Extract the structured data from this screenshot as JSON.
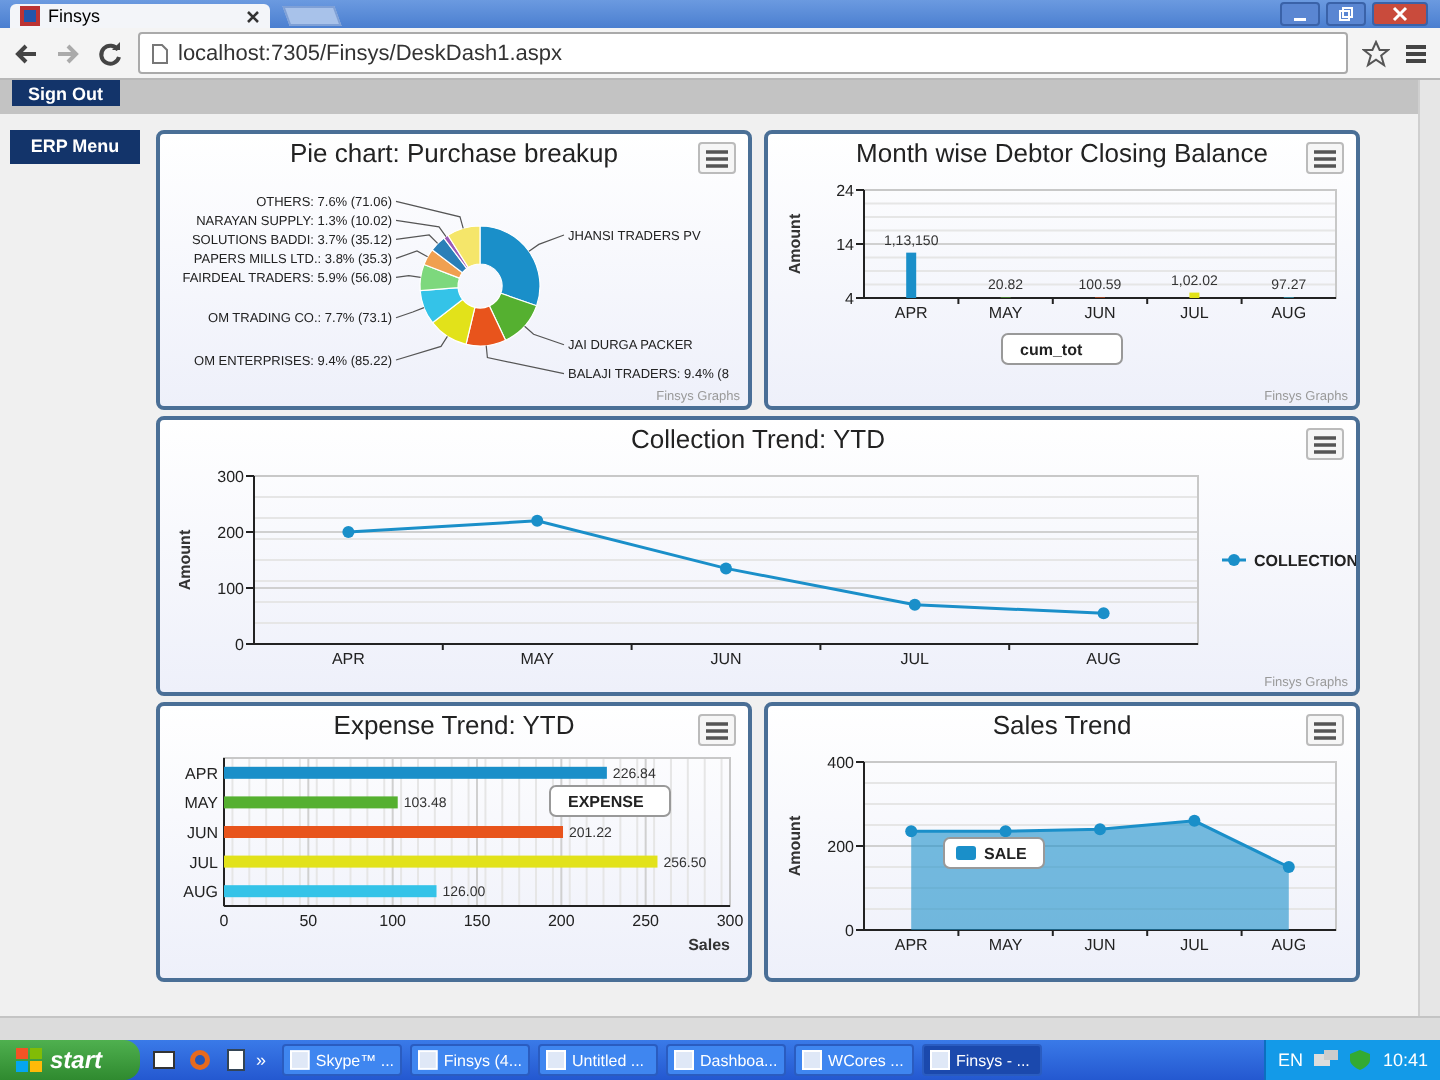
{
  "browser": {
    "tab_title": "Finsys",
    "url": "localhost:7305/Finsys/DeskDash1.aspx"
  },
  "header": {
    "sign_out": "Sign Out",
    "erp_menu": "ERP Menu"
  },
  "panels": [
    {
      "title": "Pie chart: Purchase breakup",
      "credit": "Finsys Graphs",
      "chart_data": {
        "type": "donut",
        "categories": [
          "JHANSI TRADERS PV",
          "JAI DURGA PACKER",
          "BALAJI TRADERS: 9.4% (8",
          "OM ENTERPRISES: 9.4% (85.22)",
          "OM TRADING CO.: 7.7% (73.1)",
          "FAIRDEAL TRADERS: 5.9% (56.08)",
          "PAPERS MILLS LTD.: 3.8% (35.3)",
          "SOLUTIONS BADDI: 3.7% (35.12)",
          "NARAYAN SUPPLY: 1.3% (10.02)",
          "OTHERS: 7.6% (71.06)"
        ],
        "series": [
          {
            "values": [
              240,
              100,
              85,
              85.22,
              73.1,
              56.08,
              35.3,
              35.12,
              10.02,
              71.06
            ]
          }
        ]
      },
      "legend": false
    },
    {
      "title": "Month wise Debtor Closing Balance",
      "credit": "Finsys Graphs",
      "chart_data": {
        "type": "bar",
        "orientation": "vertical",
        "ylabel": "Amount",
        "categories": [
          "APR",
          "MAY",
          "JUN",
          "JUL",
          "AUG"
        ],
        "series": [
          {
            "name": "cum_tot",
            "colors": [
              "#1a8fc9",
              "#55b030",
              "#e8541c",
              "#e2e21a",
              "#34c3e8"
            ],
            "values": [
              12.4,
              4.1,
              4.1,
              5,
              4.1
            ]
          }
        ],
        "ylim": [
          4,
          24
        ],
        "yticks": [
          4,
          14,
          24
        ],
        "grid": true,
        "value_labels": [
          "1,13,150",
          "20.82",
          "100.59",
          "1,02.02",
          "97.27"
        ]
      },
      "legend": true
    },
    {
      "title": "Collection Trend: YTD",
      "credit": "Finsys Graphs",
      "chart_data": {
        "type": "line",
        "ylabel": "Amount",
        "categories": [
          "APR",
          "MAY",
          "JUN",
          "JUL",
          "AUG"
        ],
        "series": [
          {
            "name": "COLLECTION",
            "color": "#1a8fc9",
            "marker": true,
            "values": [
              200,
              220,
              135,
              70,
              55
            ]
          }
        ],
        "ylim": [
          0,
          300
        ],
        "yticks": [
          0,
          100,
          200,
          300
        ],
        "grid": true
      },
      "legend": true
    },
    {
      "title": "Expense Trend: YTD",
      "chart_data": {
        "type": "bar",
        "orientation": "horizontal",
        "xlabel": "Sales",
        "categories": [
          "APR",
          "MAY",
          "JUN",
          "JUL",
          "AUG"
        ],
        "series": [
          {
            "name": "EXPENSE",
            "colors": [
              "#1a8fc9",
              "#55b030",
              "#e8541c",
              "#e2e21a",
              "#34c3e8"
            ],
            "values": [
              227,
              103,
              201,
              257,
              126
            ]
          }
        ],
        "xlim": [
          0,
          300
        ],
        "xticks": [
          0,
          50,
          100,
          150,
          200,
          250,
          300
        ],
        "grid": true,
        "value_labels": [
          "226.84",
          "103.48",
          "201.22",
          "256.50",
          "126.00"
        ]
      },
      "legend": true
    },
    {
      "title": "Sales Trend",
      "chart_data": {
        "type": "area",
        "ylabel": "Amount",
        "categories": [
          "APR",
          "MAY",
          "JUN",
          "JUL",
          "AUG"
        ],
        "series": [
          {
            "name": "SALE",
            "color": "#1a8fc9",
            "marker": true,
            "values": [
              235,
              235,
              240,
              260,
              150
            ]
          }
        ],
        "ylim": [
          0,
          400
        ],
        "yticks": [
          0,
          200,
          400
        ],
        "grid": true
      },
      "legend": true
    }
  ],
  "taskbar": {
    "start": "start",
    "overflow": "»",
    "tasks": [
      {
        "label": "Skype™ ...",
        "selected": false
      },
      {
        "label": "Finsys (4...",
        "selected": false
      },
      {
        "label": "Untitled ...",
        "selected": false
      },
      {
        "label": "Dashboa...",
        "selected": false
      },
      {
        "label": "WCores ...",
        "selected": false
      },
      {
        "label": "Finsys - ...",
        "selected": true
      }
    ],
    "language": "EN",
    "time": "10:41"
  }
}
